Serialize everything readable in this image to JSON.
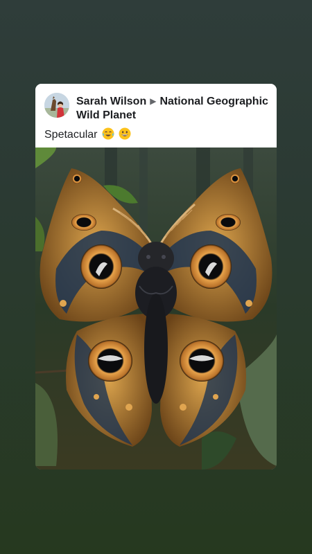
{
  "post": {
    "author": "Sarah Wilson",
    "separator_icon": "arrow-right-icon",
    "group": "National Geographic Wild Planet",
    "text": "Spetacular",
    "emojis": [
      "smiling-face-with-tears-icon",
      "grinning-face-icon"
    ]
  },
  "photo": {
    "subject_icon": "moth-icon"
  },
  "colors": {
    "background_top": "#2f3d3a",
    "background_bottom": "#26391f",
    "card": "#ffffff",
    "text": "#1c1e21",
    "wing_gold": "#c9923f",
    "wing_blue": "#1e3652"
  }
}
